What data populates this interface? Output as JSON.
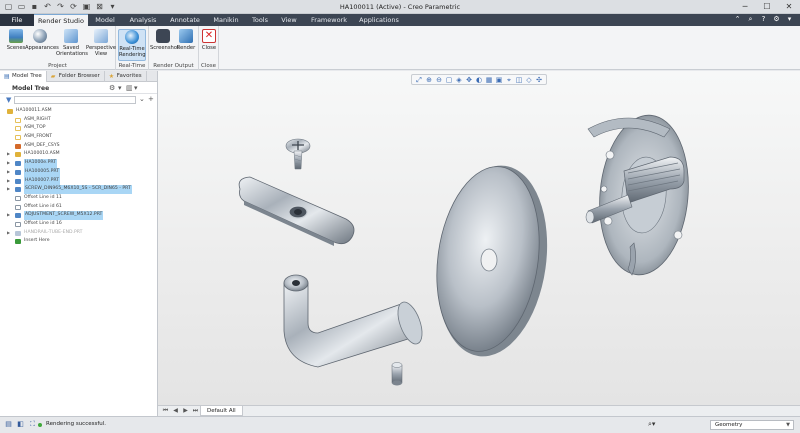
{
  "window": {
    "title": "HA100011 (Active) - Creo Parametric",
    "qat_icons": [
      "new-icon",
      "open-icon",
      "save-icon",
      "undo-icon",
      "redo-icon",
      "regenerate-icon",
      "windows-icon",
      "close-window-icon",
      "customize-icon"
    ],
    "controls": [
      "minimize",
      "maximize",
      "close"
    ]
  },
  "tabs": [
    {
      "label": "File"
    },
    {
      "label": "Render Studio"
    },
    {
      "label": "Model"
    },
    {
      "label": "Analysis"
    },
    {
      "label": "Annotate"
    },
    {
      "label": "Manikin"
    },
    {
      "label": "Tools"
    },
    {
      "label": "View"
    },
    {
      "label": "Framework"
    },
    {
      "label": "Applications"
    }
  ],
  "ribbon": {
    "groups": [
      {
        "label": "Project",
        "buttons": [
          {
            "label": "Scenes"
          },
          {
            "label": "Appearances"
          },
          {
            "label": "Saved Orientations"
          },
          {
            "label": "Perspective View"
          }
        ]
      },
      {
        "label": "Real-Time",
        "buttons": [
          {
            "label": "Real-Time Rendering"
          }
        ]
      },
      {
        "label": "Render Output",
        "buttons": [
          {
            "label": "Screenshot"
          },
          {
            "label": "Render"
          }
        ]
      },
      {
        "label": "Close",
        "buttons": [
          {
            "label": "Close"
          }
        ]
      }
    ]
  },
  "panel": {
    "tabs": [
      {
        "label": "Model Tree"
      },
      {
        "label": "Folder Browser"
      },
      {
        "label": "Favorites"
      }
    ],
    "tree_title": "Model Tree"
  },
  "tree": [
    {
      "label": "HA100011.ASM",
      "level": 0,
      "icon": "assembly",
      "expand": "",
      "hl": false
    },
    {
      "label": "ASM_RIGHT",
      "level": 1,
      "icon": "datum-plane",
      "expand": "",
      "hl": false
    },
    {
      "label": "ASM_TOP",
      "level": 1,
      "icon": "datum-plane",
      "expand": "",
      "hl": false
    },
    {
      "label": "ASM_FRONT",
      "level": 1,
      "icon": "datum-plane",
      "expand": "",
      "hl": false
    },
    {
      "label": "ASM_DEF_CSYS",
      "level": 1,
      "icon": "csys",
      "expand": "",
      "hl": false
    },
    {
      "label": "HA100010.ASM",
      "level": 1,
      "icon": "assembly",
      "expand": "▶",
      "hl": false
    },
    {
      "label": "HA1000e.PRT",
      "level": 1,
      "icon": "part",
      "expand": "▶",
      "hl": true
    },
    {
      "label": "HA100005.PRT",
      "level": 1,
      "icon": "part",
      "expand": "▶",
      "hl": true
    },
    {
      "label": "HA100007.PRT",
      "level": 1,
      "icon": "part",
      "expand": "▶",
      "hl": true
    },
    {
      "label": "SCREW_DIN965_M6X10_5S - 5CR_DIN65 - PRT",
      "level": 1,
      "icon": "part",
      "expand": "▶",
      "hl": true
    },
    {
      "label": "Offset Line id 11",
      "level": 1,
      "icon": "offset",
      "expand": "",
      "hl": false
    },
    {
      "label": "Offset Line id 61",
      "level": 1,
      "icon": "offset",
      "expand": "",
      "hl": false
    },
    {
      "label": "ADJUSTMENT_SCREW_M5X12.PRT",
      "level": 1,
      "icon": "part",
      "expand": "▶",
      "hl": true
    },
    {
      "label": "Offset Line id 16",
      "level": 1,
      "icon": "offset",
      "expand": "",
      "hl": false
    },
    {
      "label": "HANDRAIL-TUBE-END.PRT",
      "level": 1,
      "icon": "part-dim",
      "expand": "▶",
      "hl": false
    },
    {
      "label": "Insert Here",
      "level": 1,
      "icon": "insert",
      "expand": "",
      "hl": false
    }
  ],
  "viewport": {
    "toolbar_icons": [
      "refit-icon",
      "zoom-in-icon",
      "zoom-out-icon",
      "repaint-icon",
      "named-views-icon",
      "spin-center-icon",
      "display-style-icon",
      "saved-orientations-icon",
      "annotation-display-icon",
      "datum-display-icon",
      "section-icon",
      "perspective-icon",
      "appearance-icon"
    ],
    "bottom_tab": "Default All"
  },
  "status": {
    "message": "Rendering successful.",
    "filter_value": "Geometry"
  }
}
